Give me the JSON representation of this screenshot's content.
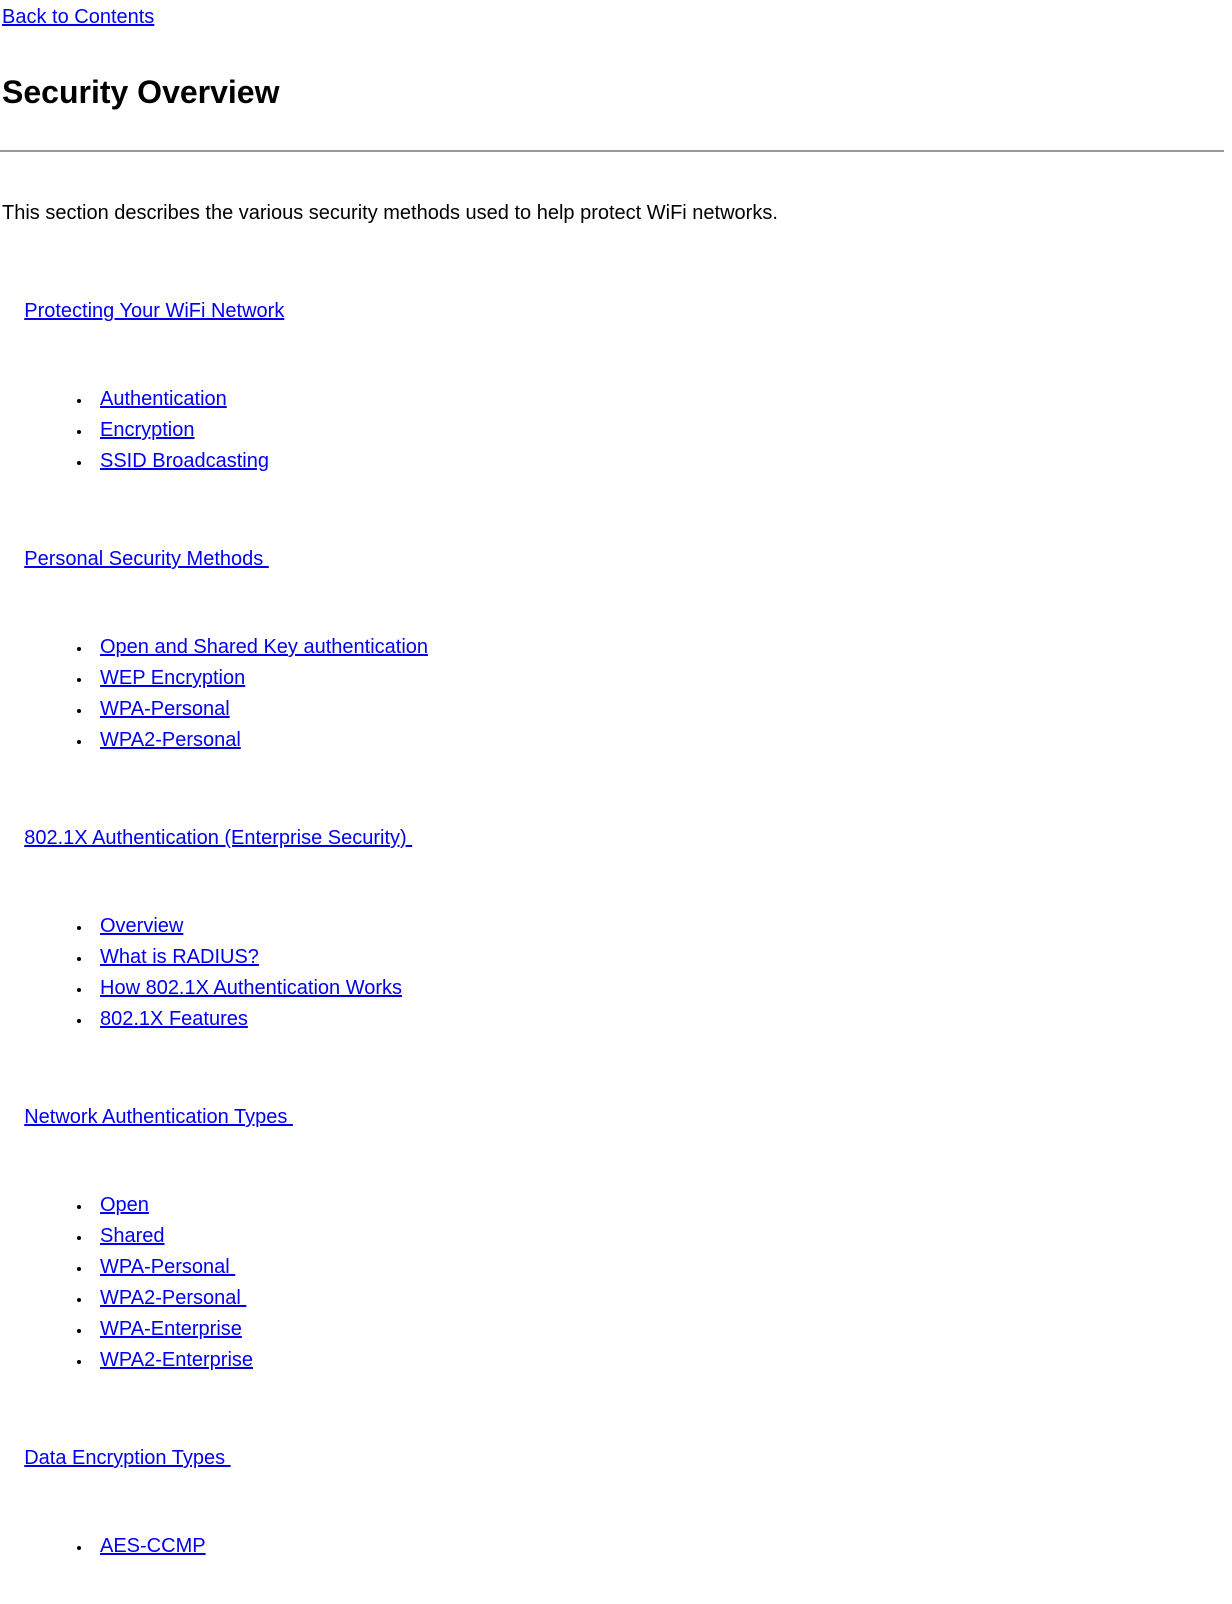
{
  "back_link": "Back to Contents",
  "title": "Security Overview",
  "intro": "This section describes the various security methods used to help protect WiFi networks.",
  "sections": [
    {
      "heading": "Protecting Your WiFi Network",
      "heading_trailing_space": false,
      "items": [
        "Authentication",
        "Encryption",
        "SSID Broadcasting"
      ]
    },
    {
      "heading": "Personal Security Methods ",
      "heading_trailing_space": true,
      "items": [
        "Open and Shared Key authentication",
        "WEP Encryption",
        "WPA-Personal",
        "WPA2-Personal"
      ]
    },
    {
      "heading": "802.1X Authentication (Enterprise Security) ",
      "heading_trailing_space": true,
      "items": [
        "Overview",
        "What is RADIUS?",
        "How 802.1X Authentication Works",
        "802.1X Features"
      ]
    },
    {
      "heading": "Network Authentication Types ",
      "heading_trailing_space": true,
      "items": [
        "Open",
        "Shared",
        "WPA-Personal ",
        "WPA2-Personal ",
        "WPA-Enterprise",
        "WPA2-Enterprise"
      ]
    },
    {
      "heading": "Data Encryption Types ",
      "heading_trailing_space": true,
      "items": [
        "AES-CCMP"
      ]
    }
  ]
}
